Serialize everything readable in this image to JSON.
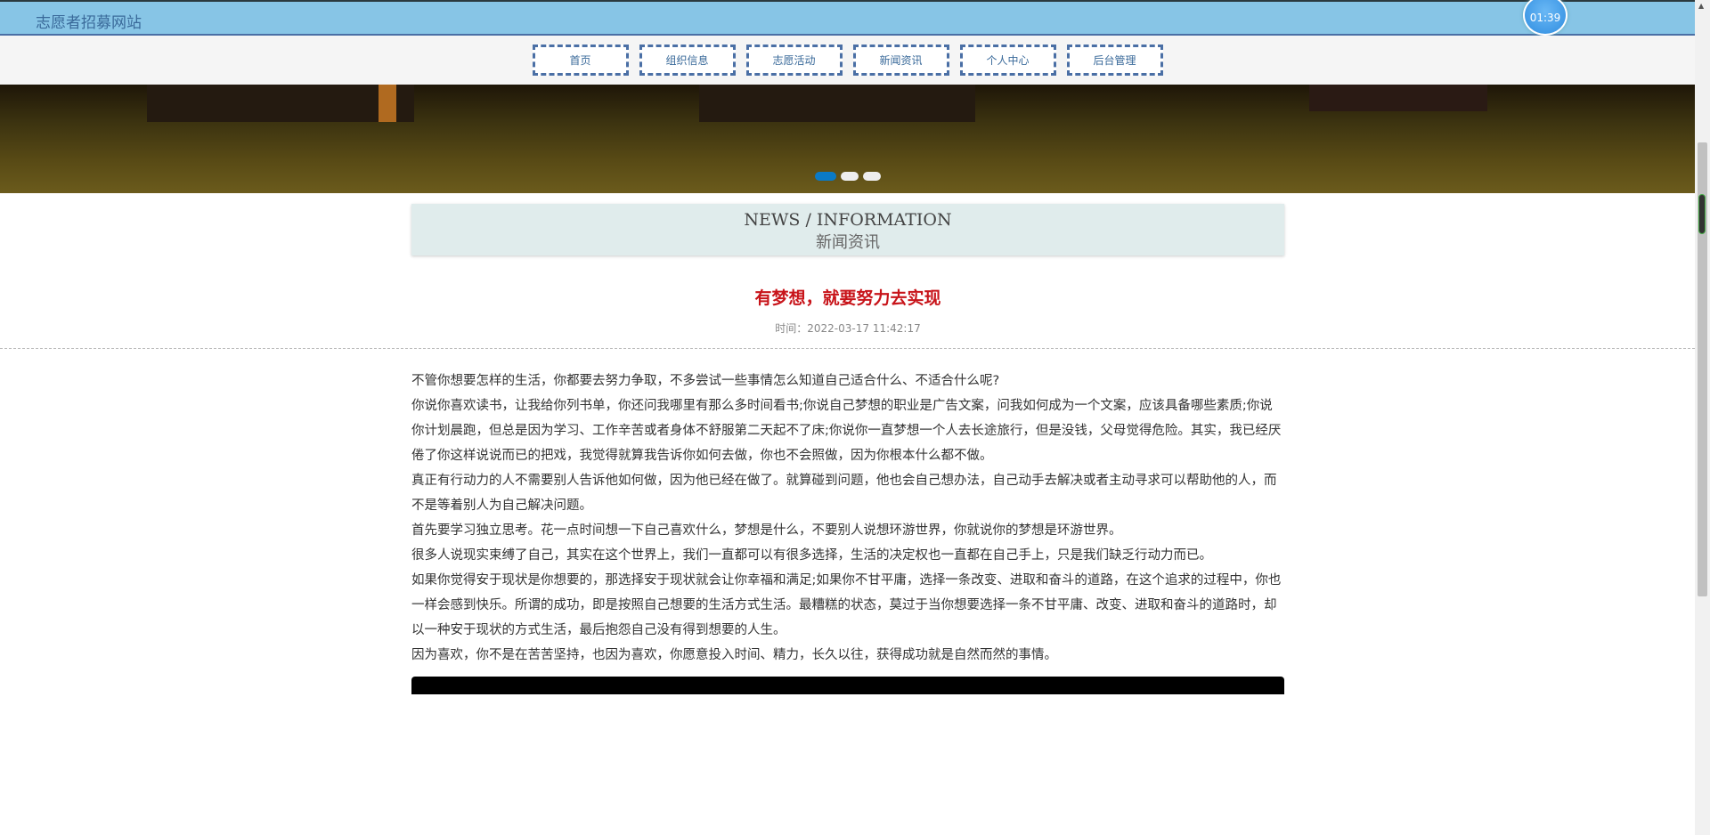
{
  "header": {
    "site_title": "志愿者招募网站",
    "clock": "01:39"
  },
  "nav": [
    "首页",
    "组织信息",
    "志愿活动",
    "新闻资讯",
    "个人中心",
    "后台管理"
  ],
  "section": {
    "en": "NEWS / INFORMATION",
    "cn": "新闻资讯"
  },
  "article": {
    "title": "有梦想，就要努力去实现",
    "time": "时间：2022-03-17 11:42:17",
    "paragraphs": [
      "不管你想要怎样的生活，你都要去努力争取，不多尝试一些事情怎么知道自己适合什么、不适合什么呢?",
      "你说你喜欢读书，让我给你列书单，你还问我哪里有那么多时间看书;你说自己梦想的职业是广告文案，问我如何成为一个文案，应该具备哪些素质;你说你计划晨跑，但总是因为学习、工作辛苦或者身体不舒服第二天起不了床;你说你一直梦想一个人去长途旅行，但是没钱，父母觉得危险。其实，我已经厌倦了你这样说说而已的把戏，我觉得就算我告诉你如何去做，你也不会照做，因为你根本什么都不做。",
      "真正有行动力的人不需要别人告诉他如何做，因为他已经在做了。就算碰到问题，他也会自己想办法，自己动手去解决或者主动寻求可以帮助他的人，而不是等着别人为自己解决问题。",
      "首先要学习独立思考。花一点时间想一下自己喜欢什么，梦想是什么，不要别人说想环游世界，你就说你的梦想是环游世界。",
      "很多人说现实束缚了自己，其实在这个世界上，我们一直都可以有很多选择，生活的决定权也一直都在自己手上，只是我们缺乏行动力而已。",
      "如果你觉得安于现状是你想要的，那选择安于现状就会让你幸福和满足;如果你不甘平庸，选择一条改变、进取和奋斗的道路，在这个追求的过程中，你也一样会感到快乐。所谓的成功，即是按照自己想要的生活方式生活。最糟糕的状态，莫过于当你想要选择一条不甘平庸、改变、进取和奋斗的道路时，却以一种安于现状的方式生活，最后抱怨自己没有得到想要的人生。",
      "因为喜欢，你不是在苦苦坚持，也因为喜欢，你愿意投入时间、精力，长久以往，获得成功就是自然而然的事情。"
    ]
  },
  "carousel": {
    "slides": 3,
    "active": 1
  }
}
